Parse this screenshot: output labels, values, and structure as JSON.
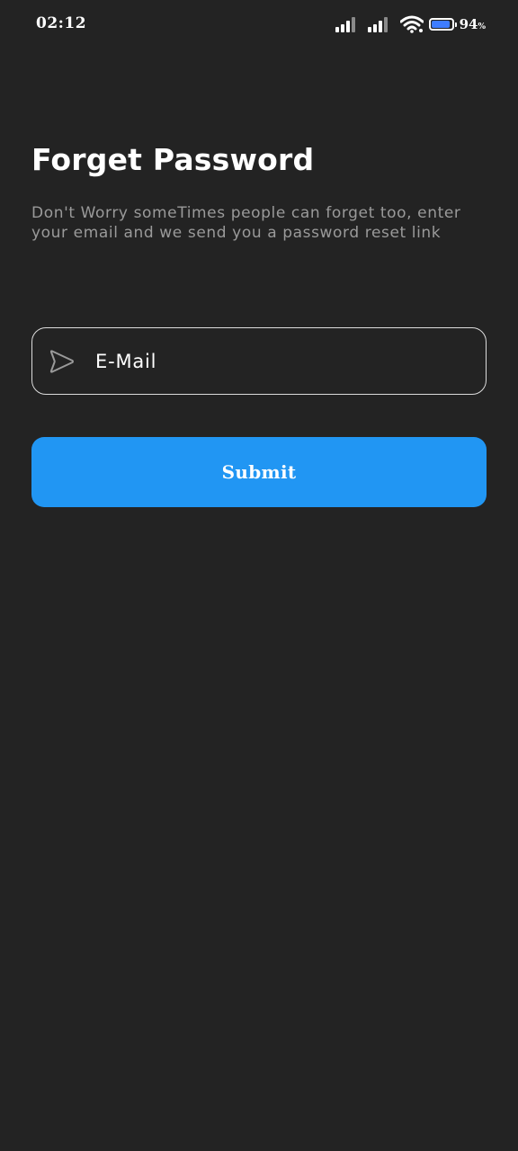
{
  "status_bar": {
    "time": "02:12",
    "battery_level": "94",
    "battery_unit": "%",
    "icons": [
      "signal-icon",
      "signal-icon",
      "wifi-icon",
      "battery-icon"
    ],
    "battery_color": "#3f7dff"
  },
  "screen": {
    "title": "Forget Password",
    "subtitle": "Don't Worry someTimes people can forget too, enter your email and we send you a password reset link",
    "email_field": {
      "placeholder": "E-Mail",
      "value": "",
      "icon": "send-icon"
    },
    "submit_label": "Submit",
    "colors": {
      "background": "#232323",
      "accent": "#2196f3",
      "subtitle": "#9a9a9a"
    }
  }
}
